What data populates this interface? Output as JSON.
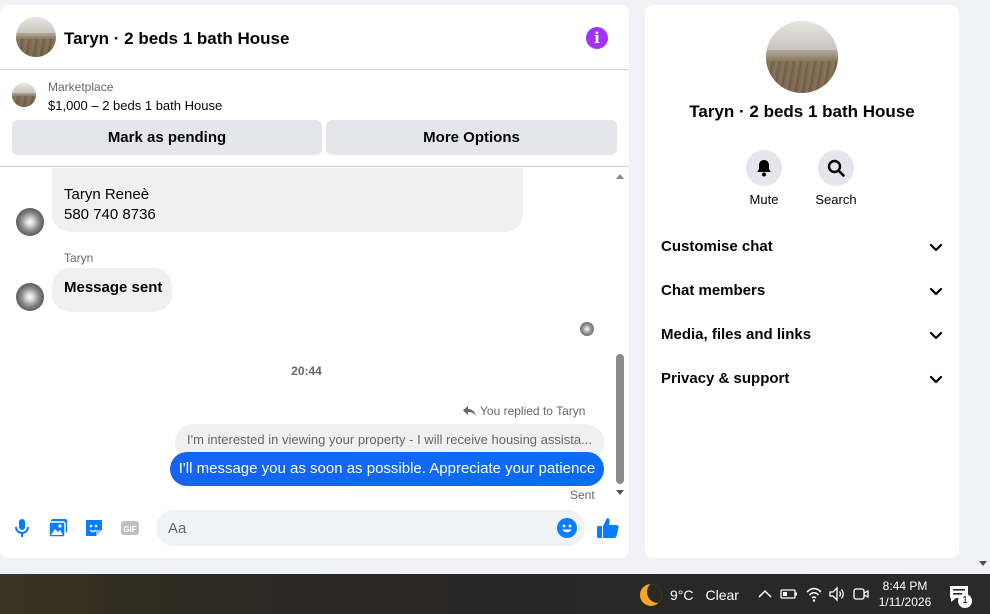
{
  "header": {
    "title": "Taryn · 2 beds 1 bath House",
    "info_icon": "info-icon"
  },
  "marketplace": {
    "label": "Marketplace",
    "listing": "$1,000 – 2 beds 1 bath House",
    "mark_pending_label": "Mark as pending",
    "more_options_label": "More Options"
  },
  "messages": {
    "contact_card_name": "Taryn Reneè",
    "contact_card_phone": "580 740 8736",
    "sender_name": "Taryn",
    "incoming_text": "Message sent",
    "timestamp": "20:44",
    "replied_label": "You replied to Taryn",
    "quoted_text": "I'm interested in viewing your property - I will receive housing assista...",
    "outgoing_text": "I'll message you as soon as possible. Appreciate your patience",
    "status": "Sent"
  },
  "composer": {
    "placeholder": "Aa",
    "icons": [
      "microphone-icon",
      "photo-icon",
      "sticker-icon",
      "gif-icon",
      "emoji-icon",
      "like-icon"
    ]
  },
  "info_panel": {
    "name": "Taryn · 2 beds 1 bath House",
    "actions": [
      {
        "label": "Mute",
        "icon": "bell-icon"
      },
      {
        "label": "Search",
        "icon": "search-icon"
      }
    ],
    "sections": [
      {
        "label": "Customise chat"
      },
      {
        "label": "Chat members"
      },
      {
        "label": "Media, files and links"
      },
      {
        "label": "Privacy & support"
      }
    ]
  },
  "taskbar": {
    "temperature": "9°C",
    "weather": "Clear",
    "time": "8:44 PM",
    "date": "1/11/2026",
    "notification_count": "1"
  },
  "colors": {
    "accent": "#0a7cff",
    "info_purple": "#a033ff",
    "bubble_gray": "#f0f0f0"
  }
}
